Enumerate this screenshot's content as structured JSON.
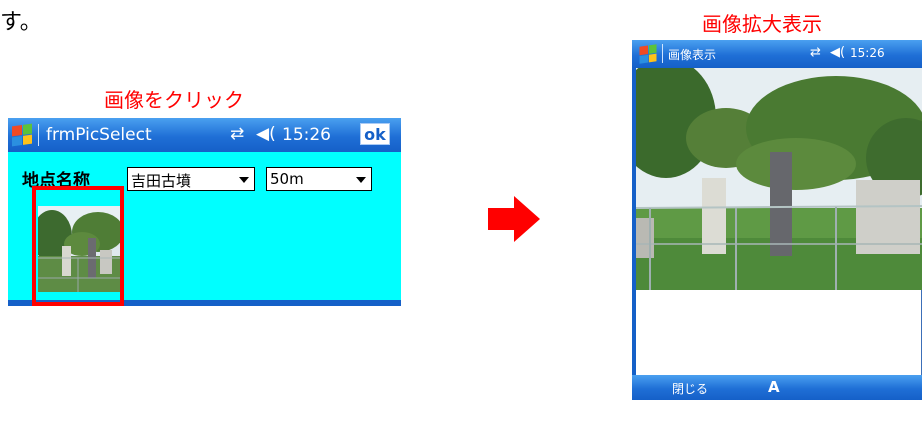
{
  "intro": {
    "text": "す。"
  },
  "captions": {
    "click_image": "画像をクリック",
    "enlarged_view": "画像拡大表示"
  },
  "left_device": {
    "title": "frmPicSelect",
    "clock": "15:26",
    "ok_label": "ok",
    "location_label": "地点名称",
    "location_value": "吉田古墳",
    "distance_value": "50m",
    "icons": [
      "windows-start-icon",
      "connectivity-icon",
      "speaker-icon",
      "dropdown-arrow-icon"
    ]
  },
  "right_device": {
    "title": "画像表示",
    "clock": "15:26",
    "close_label": "閉じる",
    "input_label": "A",
    "icons": [
      "windows-start-icon",
      "connectivity-icon",
      "speaker-icon"
    ]
  },
  "colors": {
    "form_background": "#00ffff",
    "taskbar_blue": "#1560c8",
    "caption_red": "#ff0000",
    "arrow_red": "#ff0000"
  }
}
